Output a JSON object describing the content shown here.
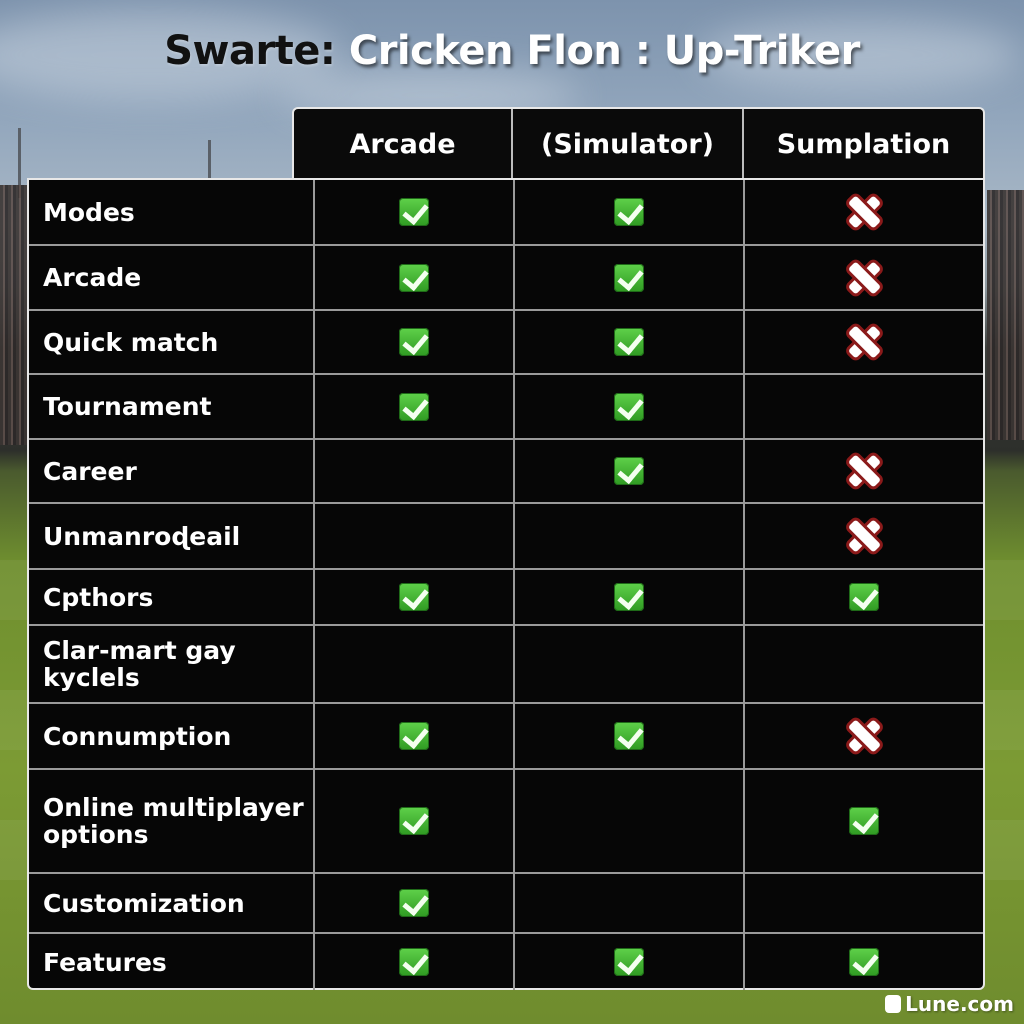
{
  "title": {
    "part1": "Swarte:",
    "part2": " Cricken Flon : Up-Triker"
  },
  "columns": [
    "Arcade",
    "(Simulator)",
    "Sumplation"
  ],
  "rows": [
    {
      "label": "Modes",
      "values": [
        "check",
        "check",
        "cross"
      ]
    },
    {
      "label": "Arcade",
      "values": [
        "check",
        "check",
        "cross"
      ]
    },
    {
      "label": "Quick match",
      "values": [
        "check",
        "check",
        "cross"
      ]
    },
    {
      "label": "Tournament",
      "values": [
        "check",
        "check",
        "none"
      ]
    },
    {
      "label": "Career",
      "values": [
        "none",
        "check",
        "cross"
      ]
    },
    {
      "label": "Unmanroɖeail",
      "values": [
        "none",
        "none",
        "cross"
      ]
    },
    {
      "label": "Cpthors",
      "values": [
        "check",
        "check",
        "check"
      ]
    },
    {
      "label": "Clar-mart gay kyclels",
      "values": [
        "none",
        "none",
        "none"
      ]
    },
    {
      "label": "Connumption",
      "values": [
        "check",
        "check",
        "cross"
      ]
    },
    {
      "label": "Online multiplayer options",
      "values": [
        "check",
        "none",
        "check"
      ]
    },
    {
      "label": "Customization",
      "values": [
        "check",
        "none",
        "none"
      ]
    },
    {
      "label": "Features",
      "values": [
        "check",
        "check",
        "check"
      ]
    }
  ],
  "icons": {
    "check": "green-check-icon",
    "cross": "red-cross-icon"
  },
  "colors": {
    "check": "#3fb52e",
    "cross_outline": "#8b1a1a",
    "table_bg": "#060606"
  },
  "watermark": "Lune.com"
}
